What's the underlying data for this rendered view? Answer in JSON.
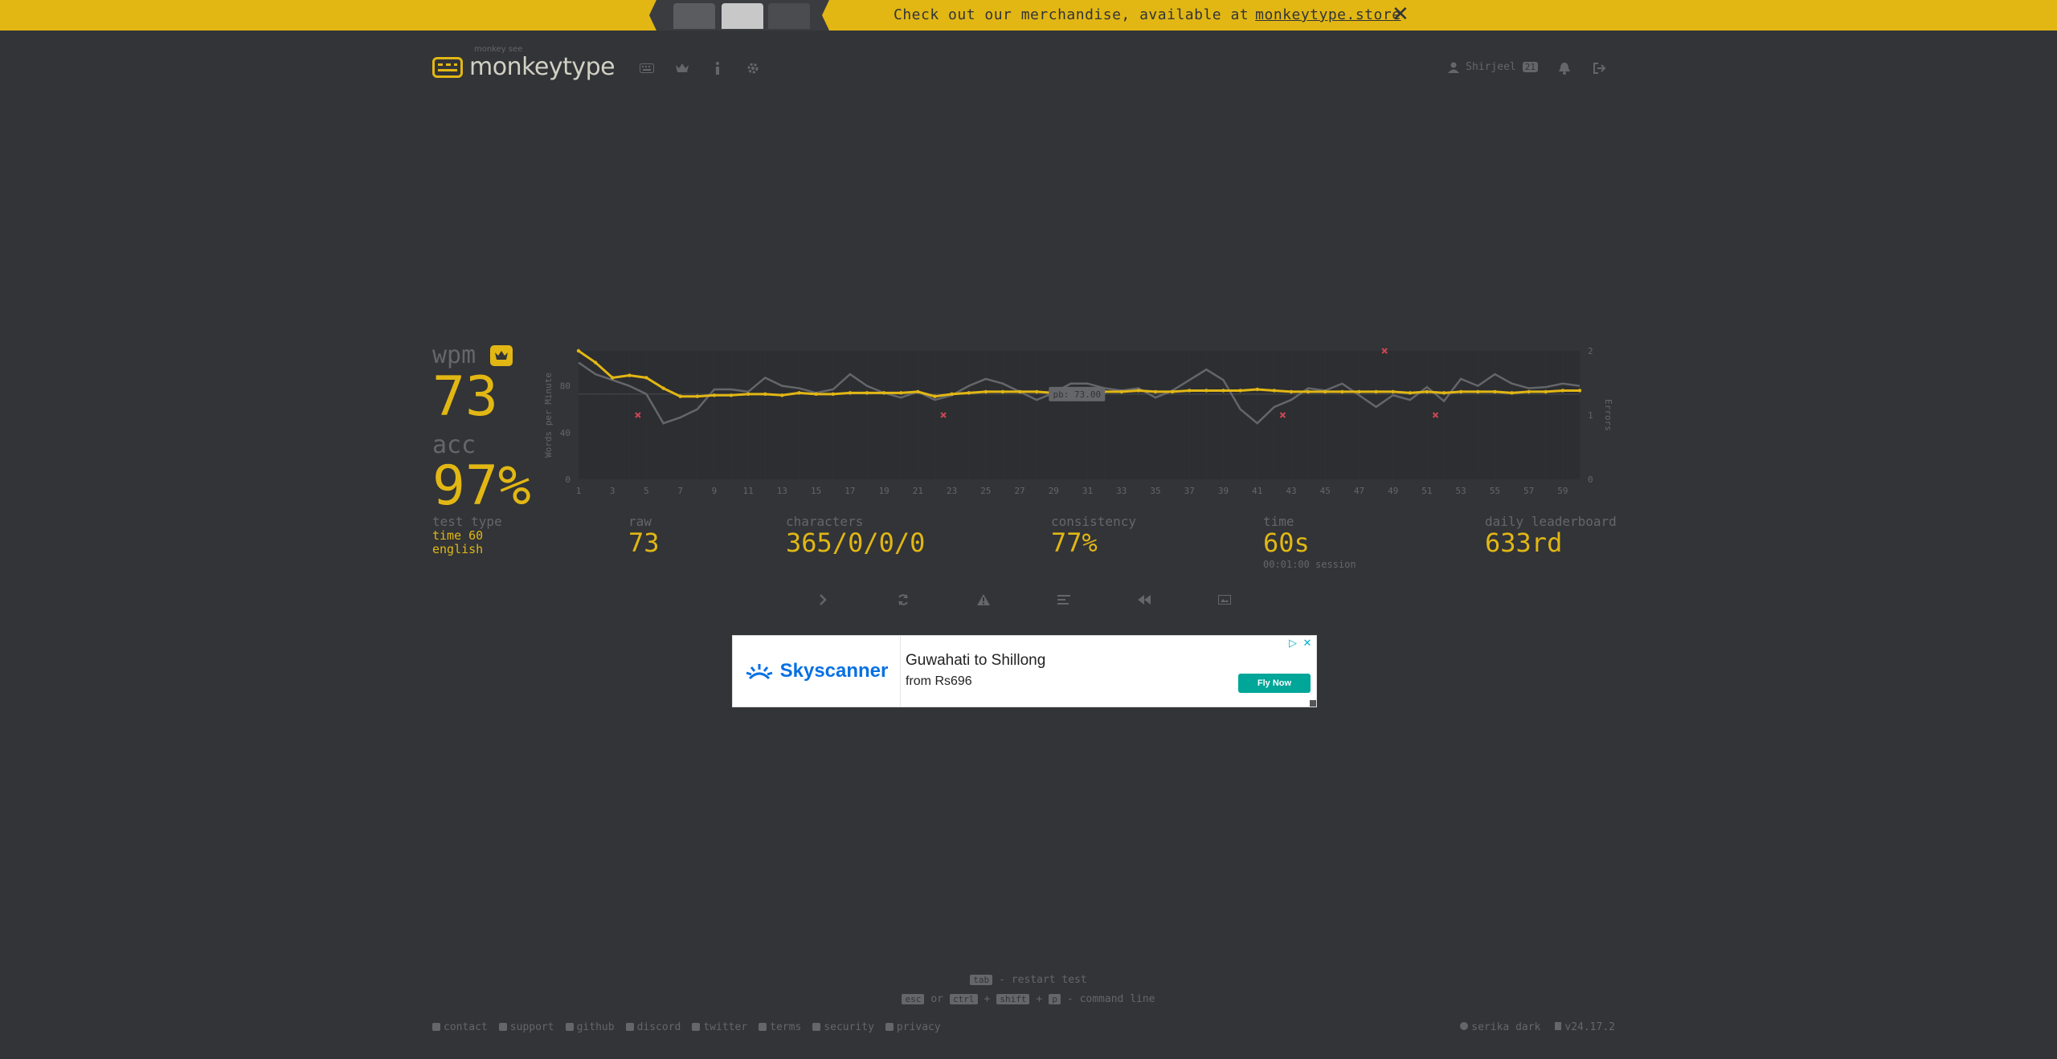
{
  "banner": {
    "text": "Check out our merchandise, available at",
    "link": "monkeytype.store"
  },
  "header": {
    "logo_top": "monkey see",
    "logo_text": "monkeytype",
    "user_name": "Shirjeel",
    "user_level": "21"
  },
  "result": {
    "wpm_label": "wpm",
    "wpm": "73",
    "acc_label": "acc",
    "acc": "97%",
    "test_type_label": "test type",
    "test_type_line1": "time 60",
    "test_type_line2": "english",
    "raw_label": "raw",
    "raw": "73",
    "characters_label": "characters",
    "characters": "365/0/0/0",
    "consistency_label": "consistency",
    "consistency": "77%",
    "time_label": "time",
    "time": "60s",
    "session": "00:01:00 session",
    "leaderboard_label": "daily leaderboard",
    "leaderboard": "633rd"
  },
  "chart_data": {
    "type": "line",
    "ylabel": "Words per Minute",
    "y2label": "Errors",
    "ylim": [
      0,
      110
    ],
    "y2lim": [
      0,
      2
    ],
    "yticks": [
      "0",
      "40",
      "80"
    ],
    "y2ticks": [
      "0",
      "1",
      "2"
    ],
    "x_ticks": [
      "1",
      "3",
      "5",
      "7",
      "9",
      "11",
      "13",
      "15",
      "17",
      "19",
      "21",
      "23",
      "25",
      "27",
      "29",
      "31",
      "33",
      "35",
      "37",
      "39",
      "41",
      "43",
      "45",
      "47",
      "49",
      "51",
      "53",
      "55",
      "57",
      "59"
    ],
    "pb_label": "pb: 73.00",
    "pb_value": 73,
    "x": [
      1,
      2,
      3,
      4,
      5,
      6,
      7,
      8,
      9,
      10,
      11,
      12,
      13,
      14,
      15,
      16,
      17,
      18,
      19,
      20,
      21,
      22,
      23,
      24,
      25,
      26,
      27,
      28,
      29,
      30,
      31,
      32,
      33,
      34,
      35,
      36,
      37,
      38,
      39,
      40,
      41,
      42,
      43,
      44,
      45,
      46,
      47,
      48,
      49,
      50,
      51,
      52,
      53,
      54,
      55,
      56,
      57,
      58,
      59,
      60
    ],
    "series": [
      {
        "name": "wpm",
        "color": "#e2b714",
        "values": [
          110,
          100,
          87,
          89,
          87,
          78,
          71,
          71,
          72,
          72,
          73,
          73,
          72,
          74,
          73,
          73,
          74,
          74,
          74,
          74,
          75,
          71,
          73,
          74,
          75,
          75,
          75,
          75,
          74,
          74,
          75,
          75,
          75,
          76,
          75,
          75,
          76,
          76,
          76,
          76,
          77,
          76,
          75,
          75,
          75,
          75,
          75,
          75,
          75,
          74,
          75,
          74,
          75,
          75,
          75,
          74,
          75,
          75,
          76,
          76
        ]
      },
      {
        "name": "raw",
        "color": "#646669",
        "values": [
          100,
          90,
          85,
          80,
          73,
          48,
          53,
          60,
          77,
          77,
          75,
          87,
          80,
          78,
          74,
          77,
          90,
          80,
          74,
          70,
          75,
          68,
          72,
          80,
          86,
          82,
          75,
          68,
          74,
          82,
          82,
          78,
          76,
          78,
          70,
          76,
          85,
          94,
          85,
          60,
          48,
          62,
          68,
          78,
          76,
          82,
          72,
          62,
          72,
          68,
          79,
          67,
          86,
          80,
          90,
          82,
          78,
          79,
          82,
          80
        ]
      }
    ],
    "errors": [
      {
        "x": 4,
        "count": 1
      },
      {
        "x": 22,
        "count": 1
      },
      {
        "x": 42,
        "count": 1
      },
      {
        "x": 48,
        "count": 2
      },
      {
        "x": 51,
        "count": 1
      }
    ]
  },
  "hints": {
    "line1_key": "tab",
    "line1_text": "- restart test",
    "line2_key1": "esc",
    "line2_or": "or",
    "line2_key2": "ctrl",
    "line2_key3": "shift",
    "line2_key4": "p",
    "line2_plus1": "+",
    "line2_plus2": "+",
    "line2_text": "- command line"
  },
  "ad": {
    "brand": "Skyscanner",
    "headline": "Guwahati to Shillong",
    "sub": "from Rs696",
    "cta": "Fly Now"
  },
  "footer": {
    "links": [
      "contact",
      "support",
      "github",
      "discord",
      "twitter",
      "terms",
      "security",
      "privacy"
    ],
    "theme": "serika dark",
    "version": "v24.17.2"
  }
}
